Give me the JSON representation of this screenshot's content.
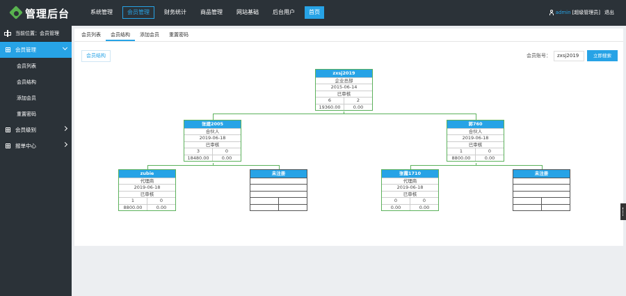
{
  "brand": {
    "title": "管理后台"
  },
  "topnav": {
    "items": [
      {
        "label": "系统管理"
      },
      {
        "label": "会员管理"
      },
      {
        "label": "财务统计"
      },
      {
        "label": "商品管理"
      },
      {
        "label": "网站基础"
      },
      {
        "label": "后台用户"
      },
      {
        "label": "首页"
      }
    ],
    "active_index": 1
  },
  "user": {
    "name": "admin",
    "role": "[超级管理员]",
    "logout": "退出"
  },
  "sidebar": {
    "location": "当前位置：会员管理",
    "menu": [
      {
        "label": "会员管理",
        "expanded": true,
        "children": [
          {
            "label": "会员列表"
          },
          {
            "label": "会员结构"
          },
          {
            "label": "添加会员"
          },
          {
            "label": "重置密码"
          }
        ]
      },
      {
        "label": "会员级别"
      },
      {
        "label": "报单中心"
      }
    ]
  },
  "tabs": [
    {
      "label": "会员列表"
    },
    {
      "label": "会员结构"
    },
    {
      "label": "添加会员"
    },
    {
      "label": "重置密码"
    }
  ],
  "active_tab": 1,
  "panel": {
    "button": "会员结构"
  },
  "search": {
    "label": "会员账号：",
    "value": "zxsj2019",
    "button": "立即搜索"
  },
  "tree": {
    "root": {
      "name": "zxsj2019",
      "role": "企业总部",
      "date": "2015-06-14",
      "status": "已审核",
      "left": "6",
      "right": "2",
      "left_amount": "19360.00",
      "right_amount": "0.00"
    },
    "level2": [
      {
        "name": "张建2005",
        "role": "合伙人",
        "date": "2019-06-18",
        "status": "已审核",
        "left": "3",
        "right": "0",
        "left_amount": "18480.00",
        "right_amount": "0.00"
      },
      {
        "name": "郭760",
        "role": "合伙人",
        "date": "2019-06-18",
        "status": "已审核",
        "left": "1",
        "right": "0",
        "left_amount": "8800.00",
        "right_amount": "0.00"
      }
    ],
    "level3": [
      {
        "name": "zubie",
        "role": "代理商",
        "date": "2019-06-18",
        "status": "已审核",
        "left": "1",
        "right": "0",
        "left_amount": "8800.00",
        "right_amount": "0.00"
      },
      {
        "name": "未注册",
        "role": "",
        "date": "",
        "status": "",
        "left": "",
        "right": "",
        "left_amount": "",
        "right_amount": ""
      },
      {
        "name": "张霞1710",
        "role": "代理商",
        "date": "2019-06-18",
        "status": "已审核",
        "left": "0",
        "right": "0",
        "left_amount": "0.00",
        "right_amount": "0.00"
      },
      {
        "name": "未注册",
        "role": "",
        "date": "",
        "status": "",
        "left": "",
        "right": "",
        "left_amount": "",
        "right_amount": ""
      }
    ]
  }
}
